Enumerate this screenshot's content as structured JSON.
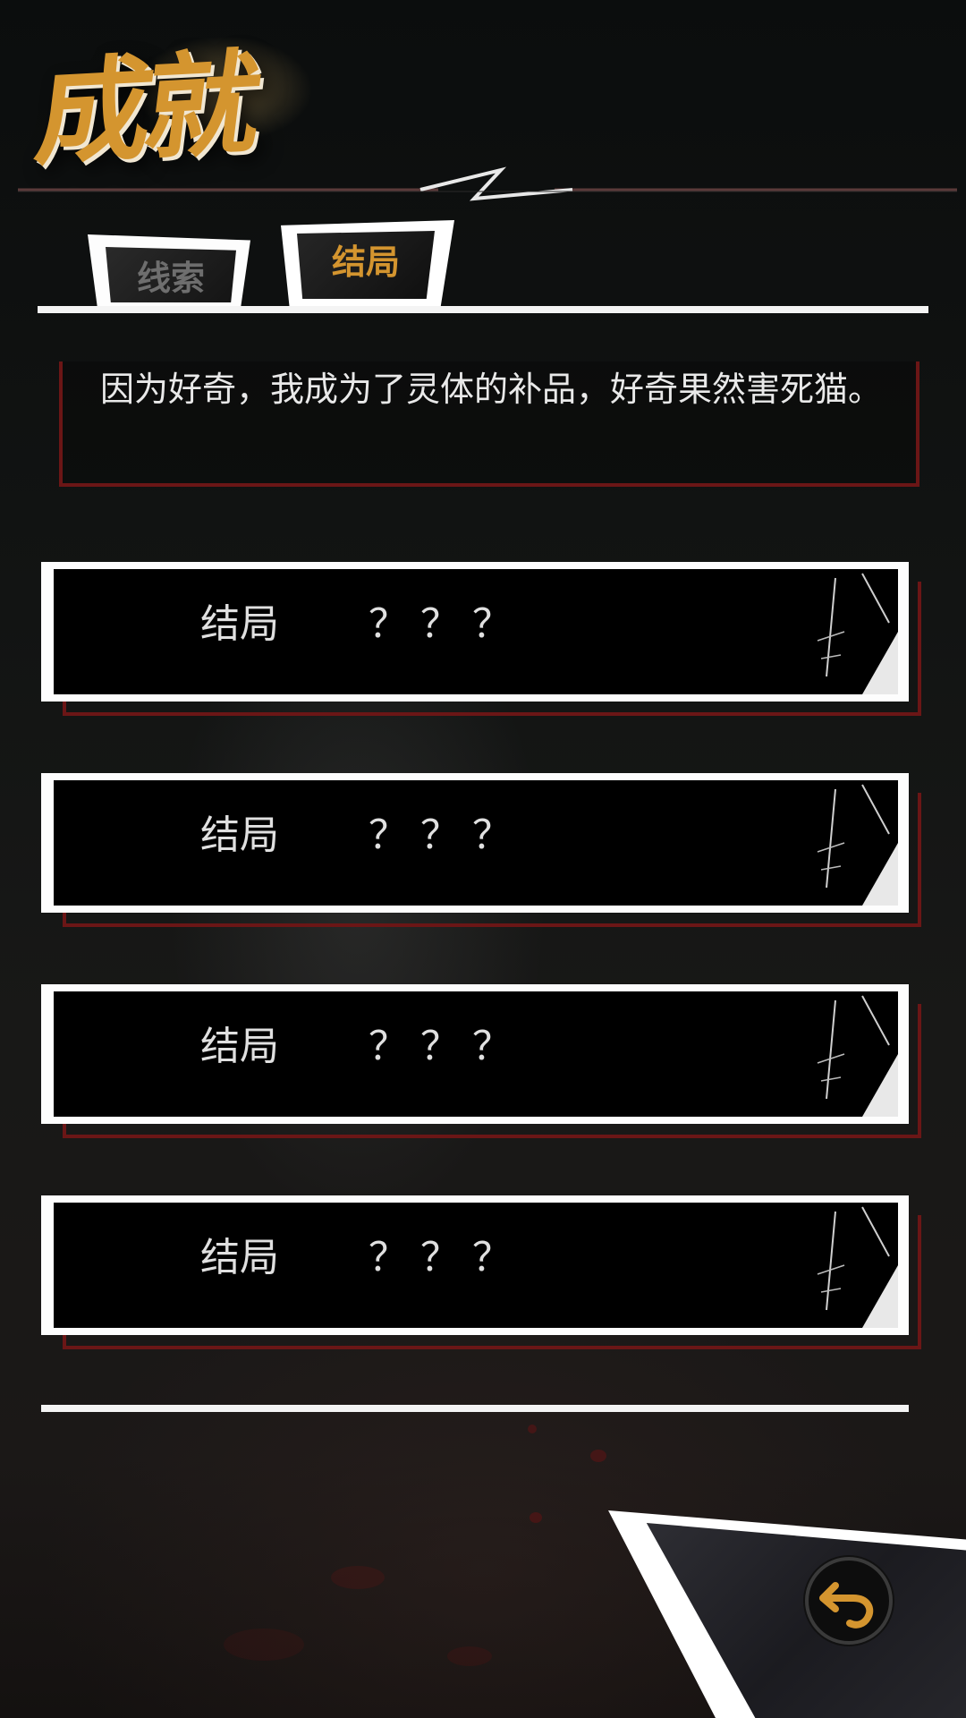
{
  "header": {
    "title": "成就"
  },
  "tabs": [
    {
      "label": "线索",
      "active": false
    },
    {
      "label": "结局",
      "active": true
    }
  ],
  "description": {
    "text": "因为好奇，我成为了灵体的补品，好奇果然害死猫。"
  },
  "endings": [
    {
      "label": "结局",
      "value": "？？？"
    },
    {
      "label": "结局",
      "value": "？？？"
    },
    {
      "label": "结局",
      "value": "？？？"
    },
    {
      "label": "结局",
      "value": "？？？"
    }
  ],
  "back_button": {
    "icon": "back-arrow-icon"
  },
  "colors": {
    "accent": "#d4952f",
    "frame": "#6b1616",
    "inactive_tab_text": "#6e6e6e"
  }
}
